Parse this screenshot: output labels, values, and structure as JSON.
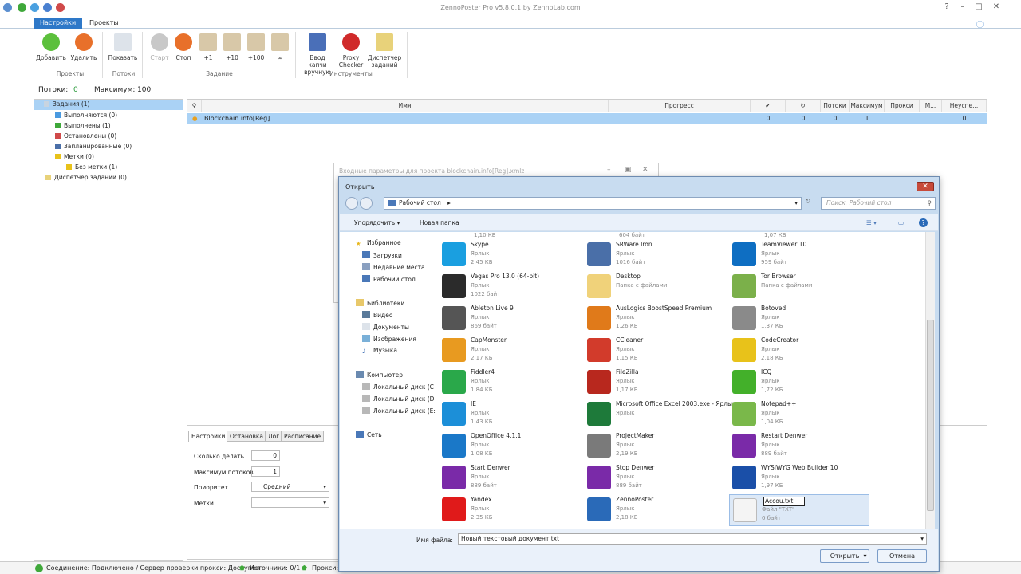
{
  "window": {
    "title": "ZennoPoster Pro v5.8.0.1 by ZennoLab.com"
  },
  "tabs": [
    {
      "label": "Настройки",
      "active": true
    },
    {
      "label": "Проекты",
      "active": false
    }
  ],
  "ribbon": {
    "buttons": [
      "Добавить",
      "Удалить",
      "Показать",
      "Старт",
      "Стоп",
      "+1",
      "+10",
      "+100",
      "∞"
    ],
    "tools": [
      "Ввод капчи вручную",
      "Proxy Checker",
      "Диспетчер заданий"
    ],
    "groups": [
      "Проекты",
      "Потоки",
      "Задание",
      "Инструменты"
    ]
  },
  "stats": {
    "threads_label": "Потоки:",
    "threads_value": "0",
    "max_label": "Максимум:",
    "max_value": "100"
  },
  "tree": [
    "Задания (1)",
    "Выполняются (0)",
    "Выполнены (1)",
    "Остановлены (0)",
    "Запланированные (0)",
    "Метки (0)",
    "Без метки (1)",
    "Диспетчер заданий (0)"
  ],
  "grid": {
    "headers": [
      "Имя",
      "Прогресс",
      "✔",
      "↻",
      "Потоки",
      "Максимум",
      "Прокси",
      "М...",
      "Неуспе..."
    ],
    "row": {
      "name": "Blockchain.info[Reg]",
      "c1": "0",
      "c2": "0",
      "c3": "0",
      "c4": "1",
      "c5": "0"
    }
  },
  "bottom_tabs": [
    "Настройки",
    "Остановка",
    "Лог",
    "Расписание"
  ],
  "settings": {
    "howmany_label": "Сколько делать",
    "howmany_value": "0",
    "maxthreads_label": "Максимум потоков",
    "maxthreads_value": "1",
    "priority_label": "Приоритет",
    "priority_value": "Средний",
    "tags_label": "Метки"
  },
  "statusbar": {
    "connection": "Соединение: Подключено / Сервер проверки прокси: Доступен",
    "sources": "Источники: 0/1",
    "proxy": "Прокси: 0"
  },
  "bg_dialog": {
    "title": "Входные параметры для проекта blockchain.info[Reg].xmlz"
  },
  "dialog": {
    "title": "Открыть",
    "address": "Рабочий стол",
    "search_placeholder": "Поиск: Рабочий стол",
    "organize": "Упорядочить",
    "new_folder": "Новая папка",
    "nav": {
      "favorites": "Избранное",
      "downloads": "Загрузки",
      "recent": "Недавние места",
      "desktop": "Рабочий стол",
      "libraries": "Библиотеки",
      "video": "Видео",
      "documents": "Документы",
      "images": "Изображения",
      "music": "Музыка",
      "computer": "Компьютер",
      "disk_c": "Локальный диск (C",
      "disk_d": "Локальный диск (D",
      "disk_e": "Локальный диск (E:",
      "network": "Сеть"
    },
    "partial_sizes": [
      "1,10 КБ",
      "604 байт",
      "1,07 КБ"
    ],
    "files": [
      {
        "name": "Skype",
        "type": "Ярлык",
        "size": "2,45 КБ",
        "color": "#1a9fe0"
      },
      {
        "name": "SRWare Iron",
        "type": "Ярлык",
        "size": "1016 байт",
        "color": "#4a6fa8"
      },
      {
        "name": "TeamViewer 10",
        "type": "Ярлык",
        "size": "959 байт",
        "color": "#0e6ec2"
      },
      {
        "name": "Vegas Pro 13.0 (64-bit)",
        "type": "Ярлык",
        "size": "1022 байт",
        "color": "#2b2b2b"
      },
      {
        "name": "Desktop",
        "type": "Папка с файлами",
        "size": "",
        "color": "#f0d27a"
      },
      {
        "name": "Tor Browser",
        "type": "Папка с файлами",
        "size": "",
        "color": "#7bb04a"
      },
      {
        "name": "Ableton Live 9",
        "type": "Ярлык",
        "size": "869 байт",
        "color": "#555555"
      },
      {
        "name": "AusLogics BoostSpeed Premium",
        "type": "Ярлык",
        "size": "1,26 КБ",
        "color": "#e07a1a"
      },
      {
        "name": "Botoved",
        "type": "Ярлык",
        "size": "1,37 КБ",
        "color": "#8a8a8a"
      },
      {
        "name": "CapMonster",
        "type": "Ярлык",
        "size": "2,17 КБ",
        "color": "#e89a20"
      },
      {
        "name": "CCleaner",
        "type": "Ярлык",
        "size": "1,15 КБ",
        "color": "#d23b2b"
      },
      {
        "name": "CodeCreator",
        "type": "Ярлык",
        "size": "2,18 КБ",
        "color": "#e8c21a"
      },
      {
        "name": "Fiddler4",
        "type": "Ярлык",
        "size": "1,84 КБ",
        "color": "#2aa84a"
      },
      {
        "name": "FileZilla",
        "type": "Ярлык",
        "size": "1,17 КБ",
        "color": "#b8281e"
      },
      {
        "name": "ICQ",
        "type": "Ярлык",
        "size": "1,72 КБ",
        "color": "#43b02a"
      },
      {
        "name": "IE",
        "type": "Ярлык",
        "size": "1,43 КБ",
        "color": "#1c8fd8"
      },
      {
        "name": "Microsoft Office Excel 2003.exe - Ярлык",
        "type": "Ярлык",
        "size": "",
        "color": "#1e7a3a"
      },
      {
        "name": "Notepad++",
        "type": "Ярлык",
        "size": "1,04 КБ",
        "color": "#7ab84a"
      },
      {
        "name": "OpenOffice 4.1.1",
        "type": "Ярлык",
        "size": "1,08 КБ",
        "color": "#1a78c8"
      },
      {
        "name": "ProjectMaker",
        "type": "Ярлык",
        "size": "2,19 КБ",
        "color": "#7a7a7a"
      },
      {
        "name": "Restart Denwer",
        "type": "Ярлык",
        "size": "889 байт",
        "color": "#7a2aa8"
      },
      {
        "name": "Start Denwer",
        "type": "Ярлык",
        "size": "889 байт",
        "color": "#7a2aa8"
      },
      {
        "name": "Stop Denwer",
        "type": "Ярлык",
        "size": "889 байт",
        "color": "#7a2aa8"
      },
      {
        "name": "WYSIWYG Web Builder 10",
        "type": "Ярлык",
        "size": "1,97 КБ",
        "color": "#1a4fa8"
      },
      {
        "name": "Yandex",
        "type": "Ярлык",
        "size": "2,35 КБ",
        "color": "#e01a1a"
      },
      {
        "name": "ZennoPoster",
        "type": "Ярлык",
        "size": "2,18 КБ",
        "color": "#2a6ab8"
      },
      {
        "name": "Accou.txt",
        "type": "Файл \"TXT\"",
        "size": "0 байт",
        "color": "#f4f4f4"
      }
    ],
    "filename_label": "Имя файла:",
    "filename_value": "Новый текстовый документ.txt",
    "open_button": "Открыть",
    "cancel_button": "Отмена"
  }
}
